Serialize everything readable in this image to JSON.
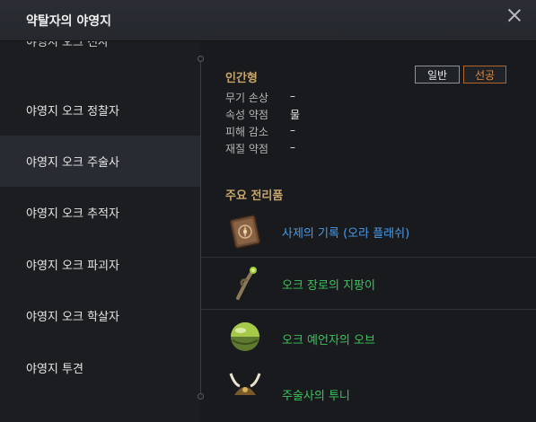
{
  "window": {
    "title": "약탈자의 야영지"
  },
  "sidebar": {
    "items": [
      {
        "label": "야영지 오크 전사"
      },
      {
        "label": "야영지 오크 정찰자"
      },
      {
        "label": "야영지 오크 주술사"
      },
      {
        "label": "야영지 오크 추적자"
      },
      {
        "label": "야영지 오크 파괴자"
      },
      {
        "label": "야영지 오크 학살자"
      },
      {
        "label": "야영지 투견"
      }
    ],
    "selected_index": 2
  },
  "detail": {
    "type_title": "인간형",
    "toggles": {
      "normal": "일반",
      "attack": "선공",
      "active": "attack"
    },
    "stats": [
      {
        "label": "무기 손상",
        "value": "–"
      },
      {
        "label": "속성 약점",
        "value": "물"
      },
      {
        "label": "피해 감소",
        "value": "–"
      },
      {
        "label": "재질 약점",
        "value": "–"
      }
    ],
    "loot_title": "주요 전리품",
    "loot": [
      {
        "name": "사제의 기록 (오라 플래쉬)",
        "color": "#4a9be8",
        "icon": "book-icon"
      },
      {
        "name": "오크 장로의 지팡이",
        "color": "#39c55a",
        "icon": "staff-icon"
      },
      {
        "name": "오크 예언자의 오브",
        "color": "#39c55a",
        "icon": "orb-icon"
      },
      {
        "name": "주술사의 투니",
        "color": "#39c55a",
        "icon": "horned-helm-icon"
      }
    ]
  },
  "colors": {
    "accent_gold": "#c8a66b",
    "attack_orange": "#e58b3c",
    "rare_blue": "#4a9be8",
    "uncommon_green": "#39c55a"
  }
}
